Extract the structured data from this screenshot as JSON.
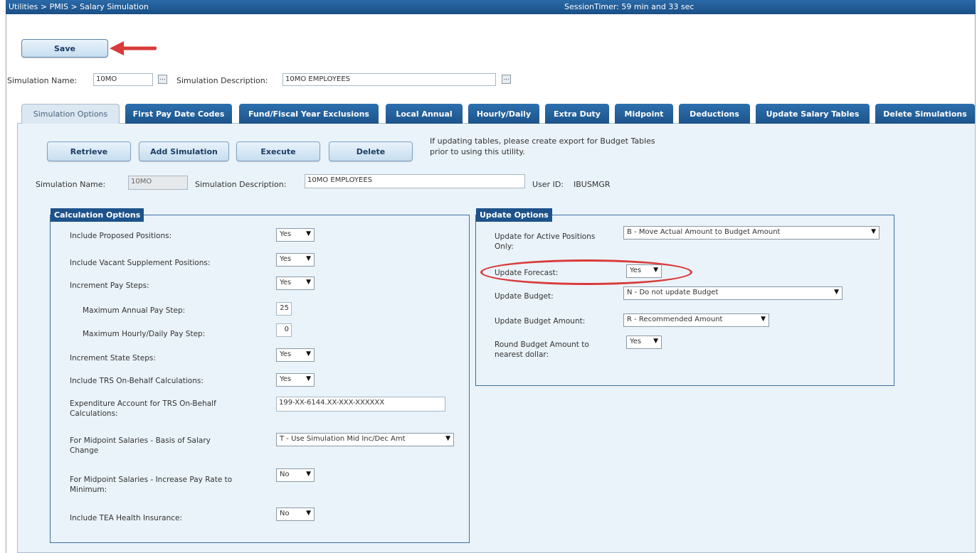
{
  "titlebar": {
    "breadcrumb": "Utilities > PMIS > Salary Simulation",
    "session_timer": "SessionTimer: 59 min and 33 sec"
  },
  "toolbar": {
    "save_label": "Save"
  },
  "header_fields": {
    "sim_name_label": "Simulation Name:",
    "sim_name_value": "10MO",
    "sim_desc_label": "Simulation Description:",
    "sim_desc_value": "10MO EMPLOYEES"
  },
  "tabs": [
    {
      "label": "Simulation Options"
    },
    {
      "label": "First Pay Date Codes"
    },
    {
      "label": "Fund/Fiscal Year Exclusions"
    },
    {
      "label": "Local Annual"
    },
    {
      "label": "Hourly/Daily"
    },
    {
      "label": "Extra Duty"
    },
    {
      "label": "Midpoint"
    },
    {
      "label": "Deductions"
    },
    {
      "label": "Update Salary Tables"
    },
    {
      "label": "Delete Simulations"
    }
  ],
  "actions": {
    "retrieve": "Retrieve",
    "add": "Add Simulation",
    "execute": "Execute",
    "delete": "Delete"
  },
  "note": {
    "line1": "If updating tables, please create export for Budget Tables",
    "line2": "prior to using this utility."
  },
  "sim_row": {
    "name_label": "Simulation Name:",
    "name_value": "10MO",
    "desc_label": "Simulation Description:",
    "desc_value": "10MO EMPLOYEES",
    "user_label": "User ID:",
    "user_value": "IBUSMGR"
  },
  "calc": {
    "title": "Calculation Options",
    "rows": [
      {
        "label": "Include Proposed Positions:",
        "value": "Yes"
      },
      {
        "label": "Include Vacant Supplement Positions:",
        "value": "Yes"
      },
      {
        "label": "Increment Pay Steps:",
        "value": "Yes"
      },
      {
        "label": "Maximum Annual Pay Step:",
        "value": "25"
      },
      {
        "label": "Maximum Hourly/Daily Pay Step:",
        "value": "0"
      },
      {
        "label": "Increment State Steps:",
        "value": "Yes"
      },
      {
        "label": "Include TRS On-Behalf Calculations:",
        "value": "Yes"
      },
      {
        "label_1": "Expenditure Account for TRS On-Behalf",
        "label_2": "Calculations:",
        "value": "199-XX-6144.XX-XXX-XXXXXX"
      },
      {
        "label_1": "For Midpoint Salaries - Basis of Salary",
        "label_2": "Change",
        "value": "T - Use Simulation Mid Inc/Dec Amt"
      },
      {
        "label_1": "For Midpoint Salaries - Increase Pay Rate to",
        "label_2": "Minimum:",
        "value": "No"
      },
      {
        "label": "Include TEA Health Insurance:",
        "value": "No"
      }
    ]
  },
  "update": {
    "title": "Update Options",
    "rows": [
      {
        "label_1": "Update for Active Positions",
        "label_2": "Only:",
        "value": "B - Move Actual Amount to Budget Amount"
      },
      {
        "label": "Update Forecast:",
        "value": "Yes"
      },
      {
        "label": "Update Budget:",
        "value": "N - Do not update Budget"
      },
      {
        "label": "Update Budget Amount:",
        "value": "R - Recommended Amount"
      },
      {
        "label_1": "Round Budget Amount to",
        "label_2": "nearest dollar:",
        "value": "Yes"
      }
    ]
  },
  "icons": {
    "caret": "▼",
    "lookup": "…"
  },
  "colors": {
    "titlebar": "#1d538a",
    "highlight": "#d93a3a",
    "arrow": "#d93a3a"
  }
}
